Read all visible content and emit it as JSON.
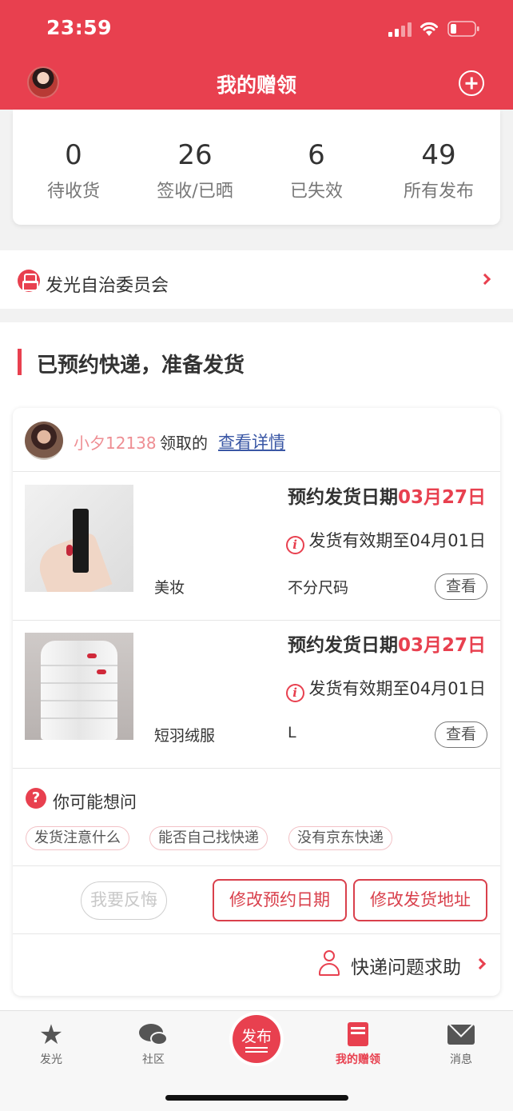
{
  "status_bar": {
    "time": "23:59"
  },
  "header": {
    "title": "我的赠领"
  },
  "stats": [
    {
      "value": "0",
      "label": "待收货"
    },
    {
      "value": "26",
      "label": "签收/已晒"
    },
    {
      "value": "6",
      "label": "已失效"
    },
    {
      "value": "49",
      "label": "所有发布"
    }
  ],
  "committee": {
    "label": "发光自治委员会"
  },
  "section": {
    "title": "已预约快递，准备发货"
  },
  "order": {
    "username": "小夕12138",
    "claimed_text": "领取的",
    "detail_link": "查看详情",
    "items": [
      {
        "schedule_prefix": "预约发货日期",
        "schedule_date": "03月27日",
        "validity": "发货有效期至04月01日",
        "category": "美妆",
        "size": "不分尺码",
        "view": "查看"
      },
      {
        "schedule_prefix": "预约发货日期",
        "schedule_date": "03月27日",
        "validity": "发货有效期至04月01日",
        "category": "短羽绒服",
        "size": "L",
        "view": "查看"
      }
    ],
    "faq": {
      "title": "你可能想问",
      "tags": [
        "发货注意什么",
        "能否自己找快递",
        "没有京东快递"
      ]
    },
    "actions": {
      "regret": "我要反悔",
      "change_date": "修改预约日期",
      "change_address": "修改发货地址"
    },
    "help": "快递问题求助"
  },
  "tab_bar": {
    "items": [
      {
        "label": "发光",
        "icon": "star-icon"
      },
      {
        "label": "社区",
        "icon": "chat-icon"
      },
      {
        "label": "发布",
        "icon": "publish-icon"
      },
      {
        "label": "我的赠领",
        "icon": "book-icon",
        "active": true
      },
      {
        "label": "消息",
        "icon": "mail-icon"
      }
    ]
  },
  "colors": {
    "accent": "#e8404f",
    "link": "#3a57a5",
    "username": "#ee8e93"
  }
}
